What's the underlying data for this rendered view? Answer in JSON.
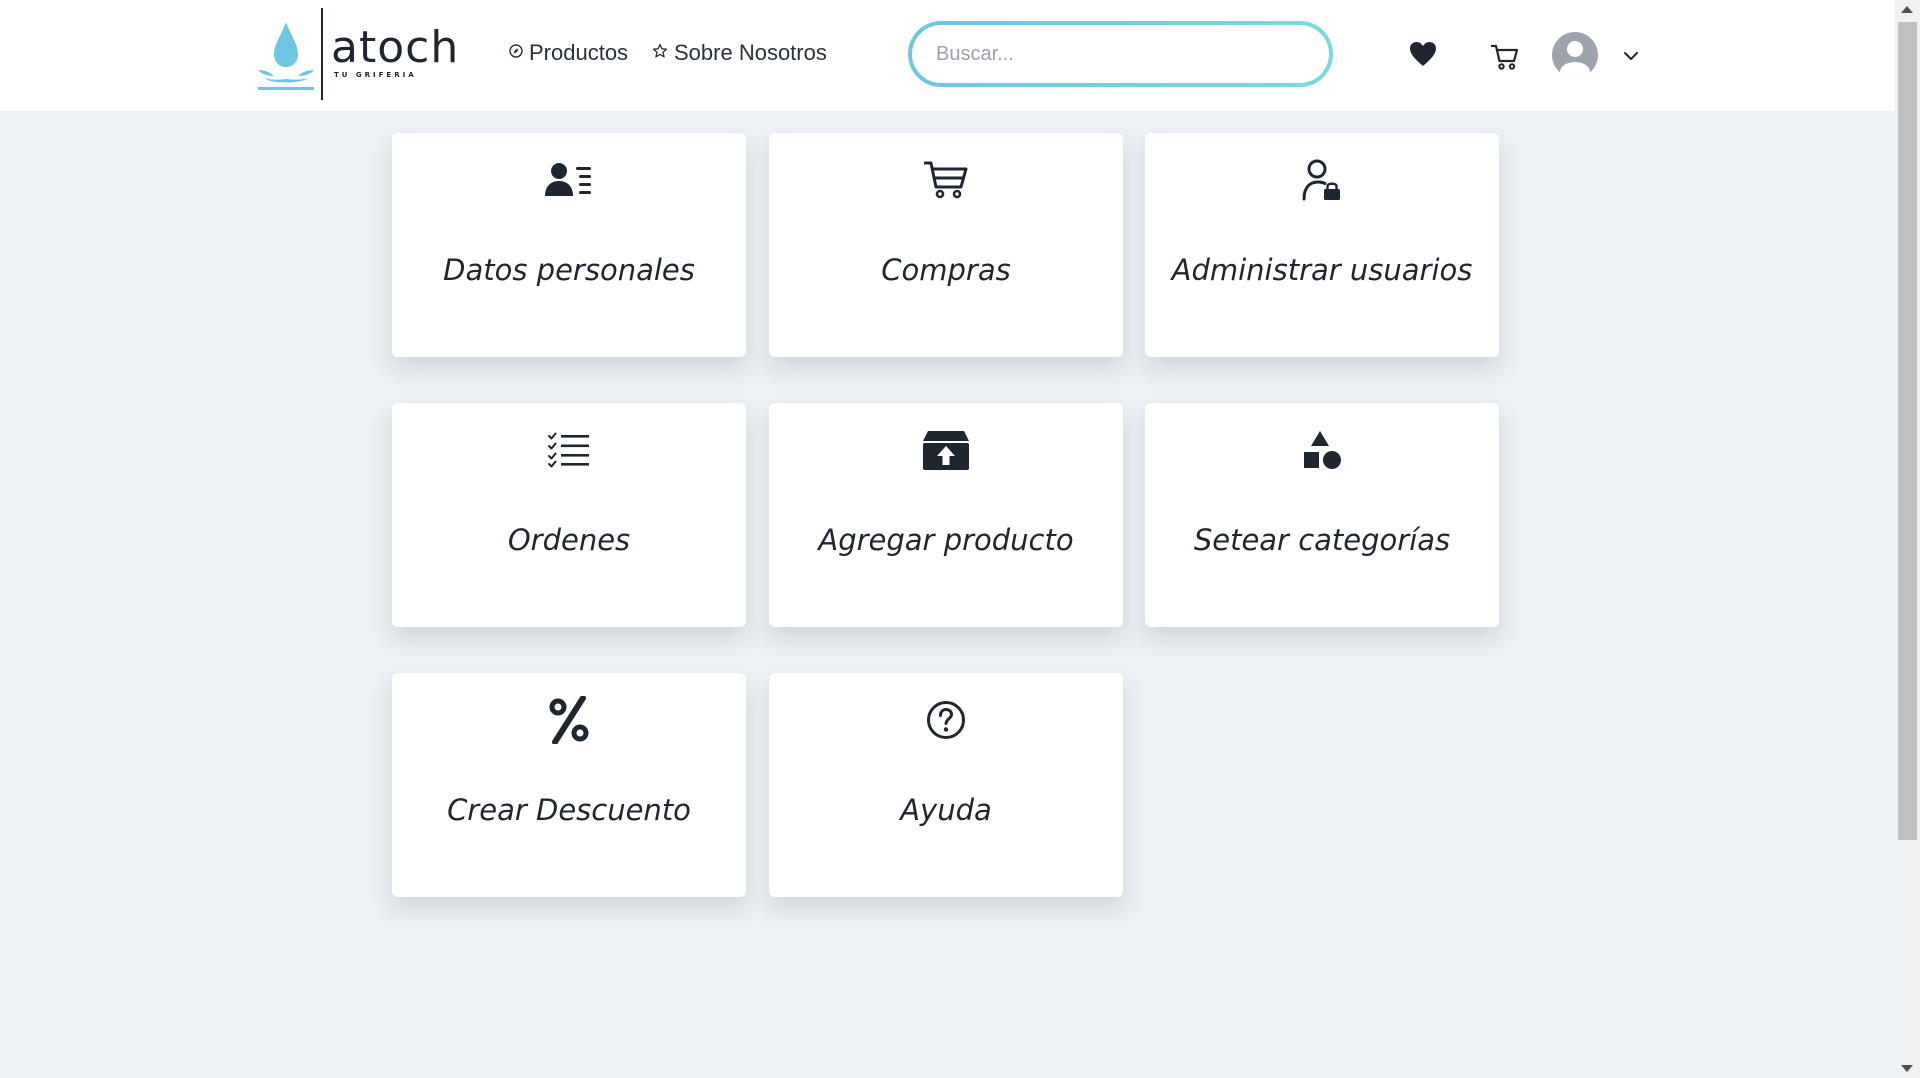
{
  "header": {
    "brand": "atoch",
    "tagline": "TU GRIFERIA",
    "nav": [
      {
        "label": "Productos",
        "icon": "compass-icon"
      },
      {
        "label": "Sobre Nosotros",
        "icon": "star-icon"
      }
    ],
    "search": {
      "placeholder": "Buscar...",
      "value": ""
    },
    "icons": [
      "heart-icon",
      "cart-icon",
      "user-avatar-icon",
      "chevron-down-icon"
    ]
  },
  "cards": [
    {
      "label": "Datos personales",
      "icon": "user-details-icon"
    },
    {
      "label": "Compras",
      "icon": "shopping-cart-icon"
    },
    {
      "label": "Administrar usuarios",
      "icon": "user-lock-icon"
    },
    {
      "label": "Ordenes",
      "icon": "checklist-icon"
    },
    {
      "label": "Agregar producto",
      "icon": "box-upload-icon"
    },
    {
      "label": "Setear categorías",
      "icon": "shapes-icon"
    },
    {
      "label": "Crear Descuento",
      "icon": "percent-icon"
    },
    {
      "label": "Ayuda",
      "icon": "question-circle-icon"
    }
  ],
  "colors": {
    "accent": "#6ec6e2",
    "accent_secondary": "#79dbd9",
    "background": "#edf1f5",
    "text": "#1f2630"
  }
}
